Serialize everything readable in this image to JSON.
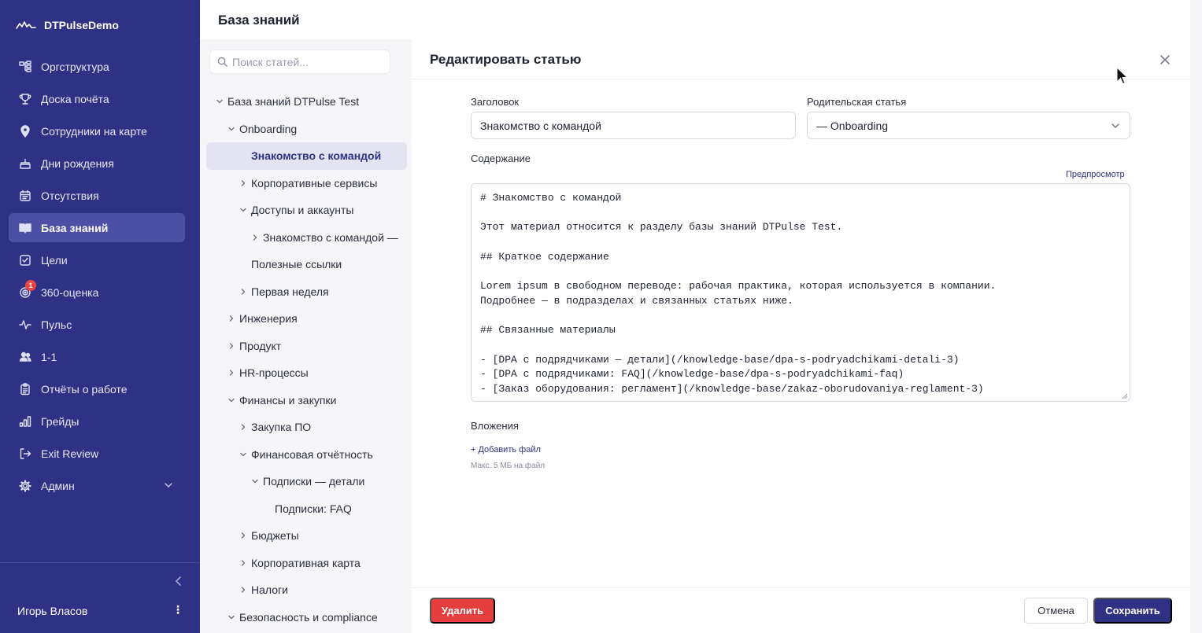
{
  "app": {
    "name": "DTPulseDemo"
  },
  "sidebar": {
    "items": [
      {
        "label": "Оргструктура",
        "icon": "org-chart-icon"
      },
      {
        "label": "Доска почёта",
        "icon": "trophy-icon"
      },
      {
        "label": "Сотрудники на карте",
        "icon": "map-pin-icon"
      },
      {
        "label": "Дни рождения",
        "icon": "cake-icon"
      },
      {
        "label": "Отсутствия",
        "icon": "calendar-icon"
      },
      {
        "label": "База знаний",
        "icon": "book-icon",
        "active": true
      },
      {
        "label": "Цели",
        "icon": "checkbox-icon"
      },
      {
        "label": "360-оценка",
        "icon": "target-icon",
        "badge": "1"
      },
      {
        "label": "Пульс",
        "icon": "pulse-icon"
      },
      {
        "label": "1-1",
        "icon": "users-icon"
      },
      {
        "label": "Отчёты о работе",
        "icon": "clipboard-icon"
      },
      {
        "label": "Грейды",
        "icon": "bar-chart-icon"
      },
      {
        "label": "Exit Review",
        "icon": "exit-icon"
      },
      {
        "label": "Админ",
        "icon": "gear-icon"
      }
    ],
    "user_name": "Игорь Власов"
  },
  "header": {
    "title": "База знаний"
  },
  "tree": {
    "search_placeholder": "Поиск статей...",
    "rows": [
      {
        "label": "База знаний DTPulse Test",
        "level": 0,
        "chevron": "down"
      },
      {
        "label": "Onboarding",
        "level": 1,
        "chevron": "down"
      },
      {
        "label": "Знакомство с командой",
        "level": 2,
        "chevron": "none",
        "selected": true
      },
      {
        "label": "Корпоративные сервисы",
        "level": 2,
        "chevron": "right"
      },
      {
        "label": "Доступы и аккаунты",
        "level": 2,
        "chevron": "down"
      },
      {
        "label": "Знакомство с командой —",
        "level": 3,
        "chevron": "right"
      },
      {
        "label": "Полезные ссылки",
        "level": 2,
        "chevron": "none"
      },
      {
        "label": "Первая неделя",
        "level": 2,
        "chevron": "right"
      },
      {
        "label": "Инженерия",
        "level": 1,
        "chevron": "right"
      },
      {
        "label": "Продукт",
        "level": 1,
        "chevron": "right"
      },
      {
        "label": "HR-процессы",
        "level": 1,
        "chevron": "right"
      },
      {
        "label": "Финансы и закупки",
        "level": 1,
        "chevron": "down"
      },
      {
        "label": "Закупка ПО",
        "level": 2,
        "chevron": "right"
      },
      {
        "label": "Финансовая отчётность",
        "level": 2,
        "chevron": "down"
      },
      {
        "label": "Подписки — детали",
        "level": 3,
        "chevron": "down"
      },
      {
        "label": "Подписки: FAQ",
        "level": 4,
        "chevron": "none"
      },
      {
        "label": "Бюджеты",
        "level": 2,
        "chevron": "right"
      },
      {
        "label": "Корпоративная карта",
        "level": 2,
        "chevron": "right"
      },
      {
        "label": "Налоги",
        "level": 2,
        "chevron": "right"
      },
      {
        "label": "Безопасность и compliance",
        "level": 1,
        "chevron": "down"
      }
    ]
  },
  "editor": {
    "title": "Редактировать статью",
    "title_label": "Заголовок",
    "title_value": "Знакомство с командой",
    "parent_label": "Родительская статья",
    "parent_value": "— Onboarding",
    "content_label": "Содержание",
    "preview_link": "Предпросмотр",
    "content": "# Знакомство с командой\n\nЭтот материал относится к разделу базы знаний DTPulse Test.\n\n## Краткое содержание\n\nLorem ipsum в свободном переводе: рабочая практика, которая используется в компании.\nПодробнее — в подразделах и связанных статьях ниже.\n\n## Связанные материалы\n\n- [DPA с подрядчиками — детали](/knowledge-base/dpa-s-podryadchikami-detali-3)\n- [DPA с подрядчиками: FAQ](/knowledge-base/dpa-s-podryadchikami-faq)\n- [Заказ оборудования: регламент](/knowledge-base/zakaz-oborudovaniya-reglament-3)",
    "attachments_label": "Вложения",
    "add_file_link": "+ Добавить файл",
    "file_hint": "Макс. 5 МБ на файл",
    "delete_button": "Удалить",
    "cancel_button": "Отмена",
    "save_button": "Сохранить"
  },
  "colors": {
    "sidebar_bg": "#2f3185",
    "sidebar_active": "#4c4fa4",
    "accent": "#2f3185",
    "danger": "#e53e3e",
    "tree_bg": "#f6f6f9"
  }
}
